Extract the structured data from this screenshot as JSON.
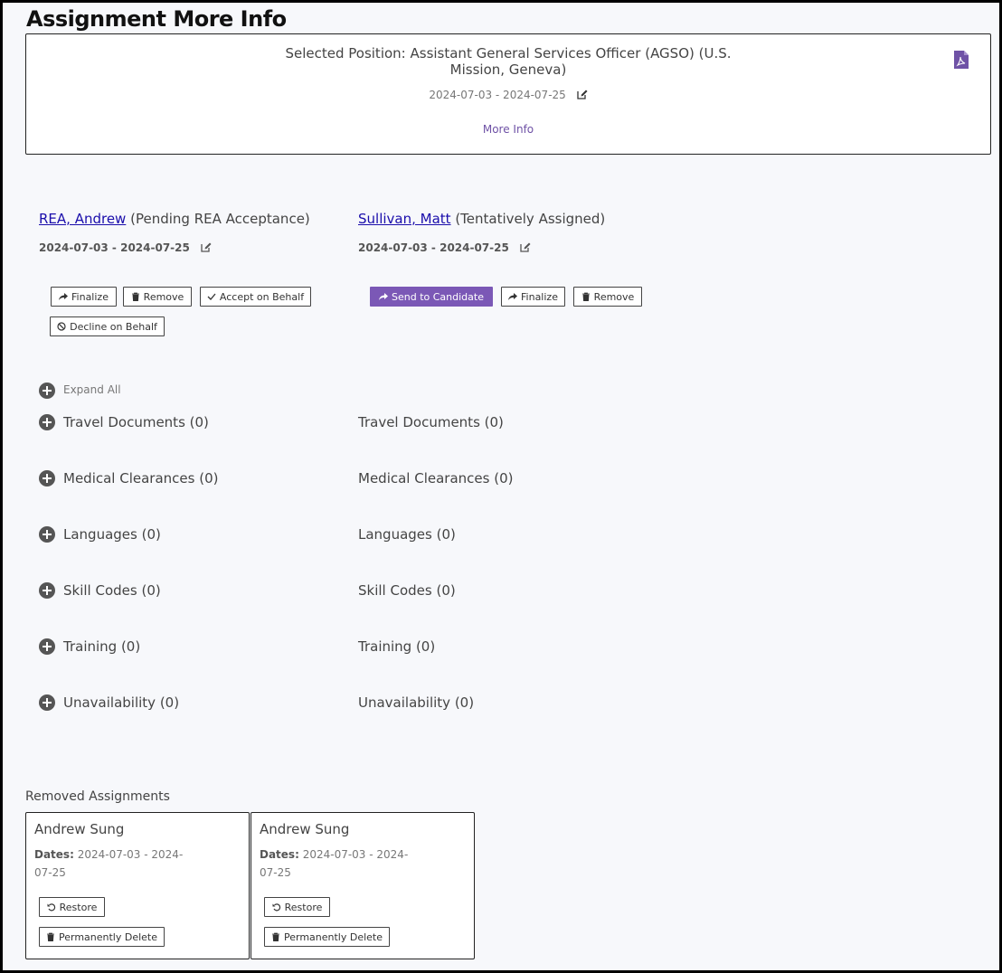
{
  "page": {
    "title": "Assignment More Info"
  },
  "position": {
    "title_line1": "Selected Position: Assistant General Services Officer (AGSO) (U.S.",
    "title_line2": "Mission, Geneva)",
    "dates": "2024-07-03 - 2024-07-25",
    "more_info": "More Info"
  },
  "candidates": [
    {
      "name": "REA, Andrew",
      "status": "(Pending REA Acceptance)",
      "dates": "2024-07-03 - 2024-07-25",
      "buttons": {
        "finalize": "Finalize",
        "remove": "Remove",
        "accept": "Accept on Behalf",
        "decline": "Decline on Behalf"
      }
    },
    {
      "name": "Sullivan, Matt",
      "status": "(Tentatively Assigned)",
      "dates": "2024-07-03 - 2024-07-25",
      "buttons": {
        "send": "Send to Candidate",
        "finalize": "Finalize",
        "remove": "Remove"
      }
    }
  ],
  "expand_all": "Expand All",
  "sections": [
    "Travel Documents (0)",
    "Medical Clearances (0)",
    "Languages (0)",
    "Skill Codes (0)",
    "Training (0)",
    "Unavailability (0)"
  ],
  "removed": {
    "title": "Removed Assignments",
    "dates_label": "Dates:",
    "restore_label": "Restore",
    "delete_label": "Permanently Delete",
    "items": [
      {
        "name": "Andrew Sung",
        "dates_line1": "2024-07-03 - 2024-",
        "dates_line2": "07-25"
      },
      {
        "name": "Andrew Sung",
        "dates_line1": "2024-07-03 - 2024-",
        "dates_line2": "07-25"
      }
    ]
  },
  "colors": {
    "accent": "#7b58b6",
    "link": "#1a0dab",
    "pdf": "#6f52a6"
  }
}
